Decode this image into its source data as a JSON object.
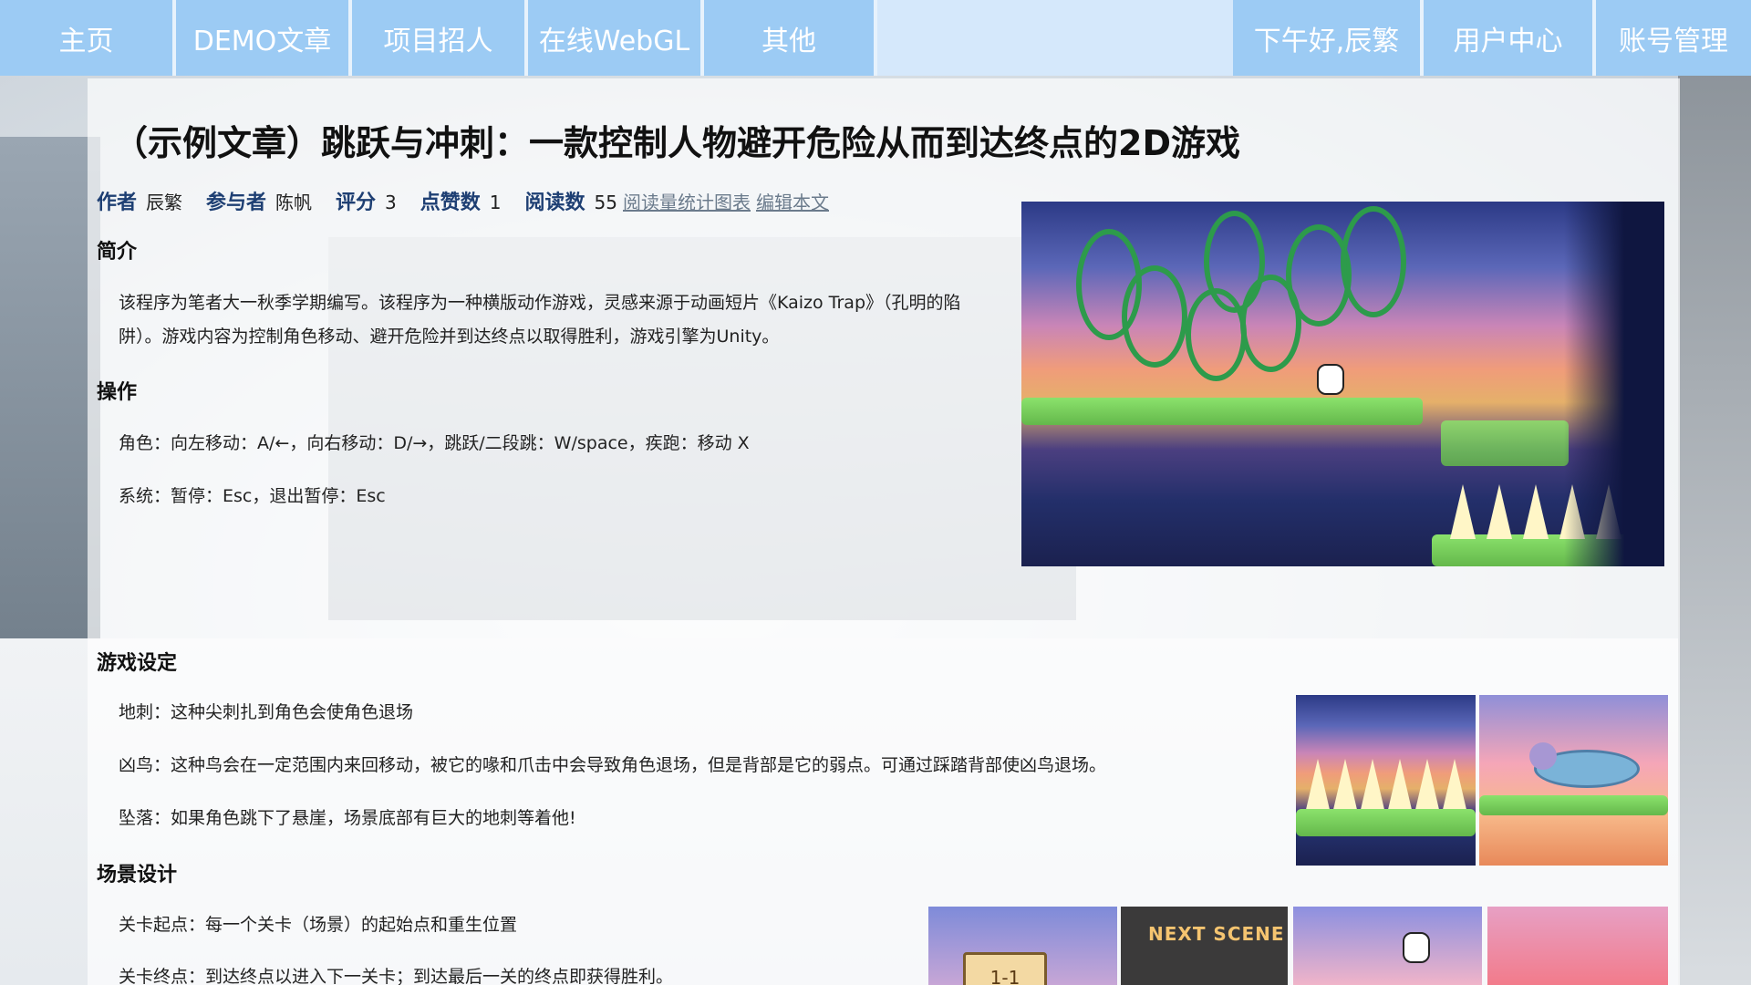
{
  "nav": {
    "left": [
      "主页",
      "DEMO文章",
      "项目招人",
      "在线WebGL",
      "其他"
    ],
    "right": [
      "下午好,辰繁",
      "用户中心",
      "账号管理"
    ]
  },
  "article": {
    "title": "（示例文章）跳跃与冲刺：一款控制人物避开危险从而到达终点的2D游戏",
    "meta": {
      "author_label": "作者",
      "author": "辰繁",
      "participant_label": "参与者",
      "participant": "陈帆",
      "rating_label": "评分",
      "rating": "3",
      "likes_label": "点赞数",
      "likes": "1",
      "reads_label": "阅读数",
      "reads": "55",
      "stats_link": "阅读量统计图表",
      "edit_link": "编辑本文"
    },
    "sections": {
      "intro_title": "简介",
      "intro_text_1": "该程序为笔者大一秋季学期编写。该程序为一种横版动作游戏，灵感来源于动画短片《Kaizo Trap》（孔明的陷",
      "intro_text_2": "阱）。游戏内容为控制角色移动、避开危险并到达终点以取得胜利，游戏引擎为Unity。",
      "controls_title": "操作",
      "controls_1": "角色：向左移动：A/←，向右移动：D/→，跳跃/二段跳：W/space，疾跑：移动 X",
      "controls_2": "系统：暂停：Esc，退出暂停：Esc",
      "settings_title": "游戏设定",
      "settings_1": "地刺：这种尖刺扎到角色会使角色退场",
      "settings_2": "凶鸟：这种鸟会在一定范围内来回移动，被它的喙和爪击中会导致角色退场，但是背部是它的弱点。可通过踩踏背部使凶鸟退场。",
      "settings_3": "坠落：如果角色跳下了悬崖，场景底部有巨大的地刺等着他!",
      "scene_title": "场景设计",
      "scene_1": "关卡起点：每一个关卡（场景）的起始点和重生位置",
      "scene_2": "关卡终点：到达终点以进入下一关卡；到达最后一关的终点即获得胜利。"
    },
    "thumbs": {
      "next_scene": "NEXT SCENE",
      "level_sign": "1-1"
    }
  }
}
